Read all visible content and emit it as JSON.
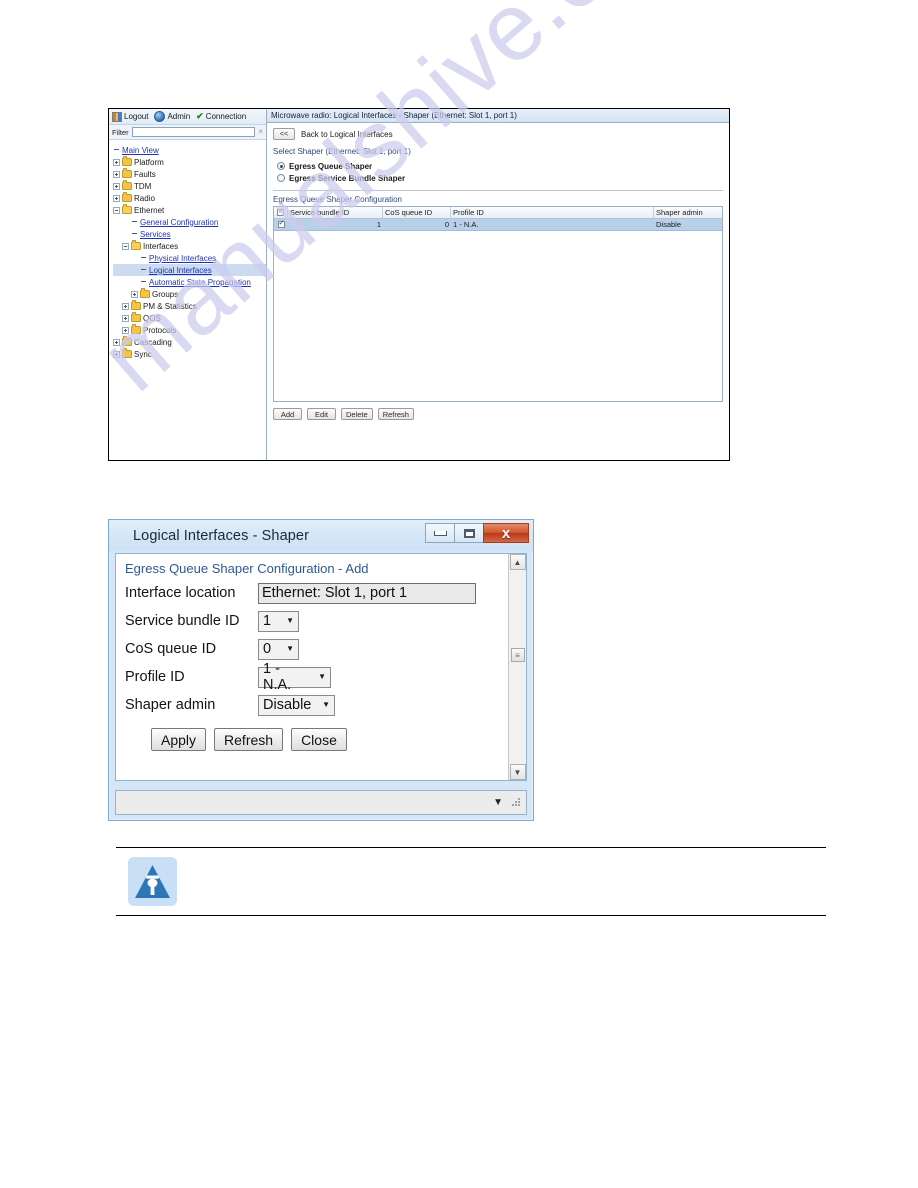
{
  "watermark": {
    "text": "manualshive.com"
  },
  "ems_window": {
    "toolbar": {
      "logout": "Logout",
      "admin": "Admin",
      "connection": "Connection"
    },
    "filter": {
      "label": "Filter",
      "value": "",
      "placeholder": "",
      "clear_icon": "×"
    },
    "tree": [
      {
        "label": "Main View",
        "indent": 0,
        "expander": "none",
        "folder": false,
        "link": true,
        "selected": false
      },
      {
        "label": "Platform",
        "indent": 0,
        "expander": "plus",
        "folder": true,
        "link": false,
        "selected": false
      },
      {
        "label": "Faults",
        "indent": 0,
        "expander": "plus",
        "folder": true,
        "link": false,
        "selected": false
      },
      {
        "label": "TDM",
        "indent": 0,
        "expander": "plus",
        "folder": true,
        "link": false,
        "selected": false
      },
      {
        "label": "Radio",
        "indent": 0,
        "expander": "plus",
        "folder": true,
        "link": false,
        "selected": false
      },
      {
        "label": "Ethernet",
        "indent": 0,
        "expander": "minus",
        "folder": true,
        "link": false,
        "selected": false
      },
      {
        "label": "General Configuration",
        "indent": 2,
        "expander": "none",
        "folder": false,
        "link": true,
        "selected": false
      },
      {
        "label": "Services",
        "indent": 2,
        "expander": "none",
        "folder": false,
        "link": true,
        "selected": false
      },
      {
        "label": "Interfaces",
        "indent": 1,
        "expander": "minus",
        "folder": true,
        "link": false,
        "selected": false
      },
      {
        "label": "Physical Interfaces",
        "indent": 3,
        "expander": "none",
        "folder": false,
        "link": true,
        "selected": false
      },
      {
        "label": "Logical Interfaces",
        "indent": 3,
        "expander": "none",
        "folder": false,
        "link": true,
        "selected": true
      },
      {
        "label": "Automatic State Propagation",
        "indent": 3,
        "expander": "none",
        "folder": false,
        "link": true,
        "selected": false
      },
      {
        "label": "Groups",
        "indent": 2,
        "expander": "plus",
        "folder": true,
        "link": false,
        "selected": false
      },
      {
        "label": "PM & Statistics",
        "indent": 1,
        "expander": "plus",
        "folder": true,
        "link": false,
        "selected": false
      },
      {
        "label": "QOS",
        "indent": 1,
        "expander": "plus",
        "folder": true,
        "link": false,
        "selected": false
      },
      {
        "label": "Protocols",
        "indent": 1,
        "expander": "plus",
        "folder": true,
        "link": false,
        "selected": false
      },
      {
        "label": "Cascading",
        "indent": 0,
        "expander": "plus",
        "folder": true,
        "link": false,
        "selected": false
      },
      {
        "label": "Sync",
        "indent": 0,
        "expander": "plus",
        "folder": true,
        "link": false,
        "selected": false
      }
    ],
    "content": {
      "header": "Microwave radio: Logical Interfaces - Shaper (Ethernet: Slot 1, port 1)",
      "back_button": "<<",
      "back_label": "Back to Logical Interfaces",
      "select_shaper_label": "Select Shaper (Ethernet: Slot 1, port 1)",
      "radios": [
        {
          "label": "Egress Queue Shaper",
          "selected": true
        },
        {
          "label": "Egress Service Bundle Shaper",
          "selected": false
        }
      ],
      "grid_title": "Egress Queue Shaper Configuration",
      "grid_columns": [
        "Service bundle ID",
        "CoS queue ID",
        "Profile ID",
        "Shaper admin"
      ],
      "grid_rows": [
        {
          "checked": true,
          "service_bundle_id": "1",
          "cos_queue_id": "0",
          "profile_id": "1 - N.A.",
          "shaper_admin": "Disable"
        }
      ],
      "buttons": [
        "Add",
        "Edit",
        "Delete",
        "Refresh"
      ]
    }
  },
  "shaper_dialog": {
    "title": "Logical Interfaces - Shaper",
    "window_buttons": {
      "minimize": "minimize-icon",
      "maximize": "maximize-icon",
      "close": "x"
    },
    "form_title": "Egress Queue Shaper Configuration - Add",
    "fields": [
      {
        "label": "Interface location",
        "value": "Ethernet: Slot 1, port 1",
        "control": "text"
      },
      {
        "label": "Service bundle ID",
        "value": "1",
        "control": "select"
      },
      {
        "label": "CoS queue ID",
        "value": "0",
        "control": "select"
      },
      {
        "label": "Profile ID",
        "value": "1 - N.A.",
        "control": "select"
      },
      {
        "label": "Shaper admin",
        "value": "Disable",
        "control": "select"
      }
    ],
    "buttons": [
      "Apply",
      "Refresh",
      "Close"
    ],
    "scroll": {
      "up": "▲",
      "down": "▼",
      "thumb": "≡"
    },
    "status_caret": "▼"
  },
  "note": {
    "icon_name": "note-triangle-icon"
  }
}
